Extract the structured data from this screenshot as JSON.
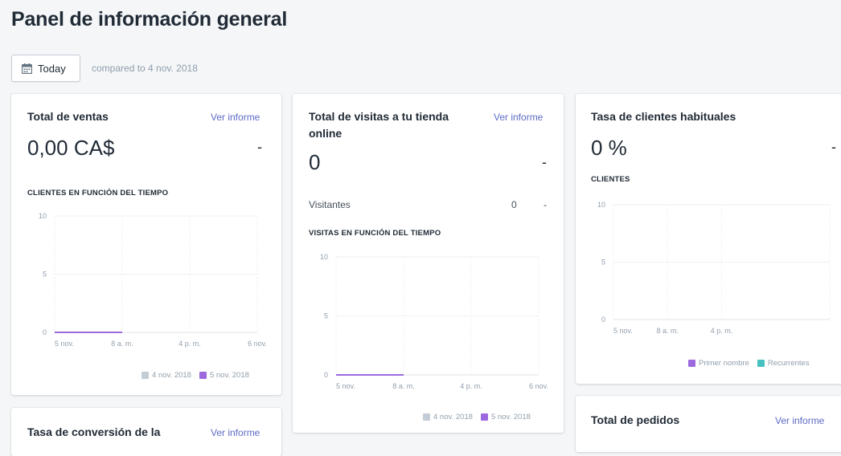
{
  "page": {
    "title": "Panel de información general"
  },
  "date_filter": {
    "label": "Today",
    "compare_text": "compared to 4 nov. 2018"
  },
  "cards": {
    "sales": {
      "title": "Total de ventas",
      "link": "Ver informe",
      "value": "0,00 CA$",
      "change": "-",
      "chart_label": "CLIENTES EN FUNCIÓN DEL TIEMPO"
    },
    "visits": {
      "title_line1": "Total de visitas a tu tienda",
      "title_line2": "online",
      "link": "Ver informe",
      "value": "0",
      "change": "-",
      "row_label": "Visitantes",
      "row_value": "0",
      "row_change": "-",
      "chart_label": "VISITAS EN FUNCIÓN DEL TIEMPO"
    },
    "returning": {
      "title": "Tasa de clientes habituales",
      "value": "0 %",
      "change": "-",
      "chart_label": "CLIENTES"
    },
    "conversion": {
      "title": "Tasa de conversión de la",
      "link": "Ver informe"
    },
    "orders": {
      "title": "Total de pedidos",
      "link": "Ver informe"
    }
  },
  "colors": {
    "series_prev": "#c4cdd5",
    "series_curr": "#9c6ade",
    "returning": "#47c1bf",
    "link": "#5c6ac4"
  },
  "chart_data": [
    {
      "type": "line",
      "title": "CLIENTES EN FUNCIÓN DEL TIEMPO",
      "x_ticks": [
        "5 nov.",
        "8 a. m.",
        "4 p. m.",
        "6 nov."
      ],
      "y_ticks": [
        "0",
        "5",
        "10"
      ],
      "ylim": [
        0,
        10
      ],
      "grid": true,
      "legend_position": "bottom-right",
      "series": [
        {
          "name": "4 nov. 2018",
          "color": "#c4cdd5",
          "x": [],
          "y": []
        },
        {
          "name": "5 nov. 2018",
          "color": "#9c6ade",
          "x": [
            0,
            1
          ],
          "y": [
            0,
            0
          ]
        }
      ]
    },
    {
      "type": "line",
      "title": "VISITAS EN FUNCIÓN DEL TIEMPO",
      "x_ticks": [
        "5 nov.",
        "8 a. m.",
        "4 p. m.",
        "6 nov."
      ],
      "y_ticks": [
        "0",
        "5",
        "10"
      ],
      "ylim": [
        0,
        10
      ],
      "grid": true,
      "legend_position": "bottom-right",
      "series": [
        {
          "name": "4 nov. 2018",
          "color": "#c4cdd5",
          "x": [],
          "y": []
        },
        {
          "name": "5 nov. 2018",
          "color": "#9c6ade",
          "x": [
            0,
            1
          ],
          "y": [
            0,
            0
          ]
        }
      ]
    },
    {
      "type": "bar",
      "title": "CLIENTES",
      "x_ticks": [
        "5 nov.",
        "8 a. m.",
        "4 p. m."
      ],
      "y_ticks": [
        "0",
        "5",
        "10"
      ],
      "ylim": [
        0,
        10
      ],
      "grid": true,
      "legend_position": "bottom-right",
      "series": [
        {
          "name": "Primer nombre",
          "color": "#9c6ade",
          "values": []
        },
        {
          "name": "Recurrentes",
          "color": "#47c1bf",
          "values": []
        }
      ]
    }
  ]
}
